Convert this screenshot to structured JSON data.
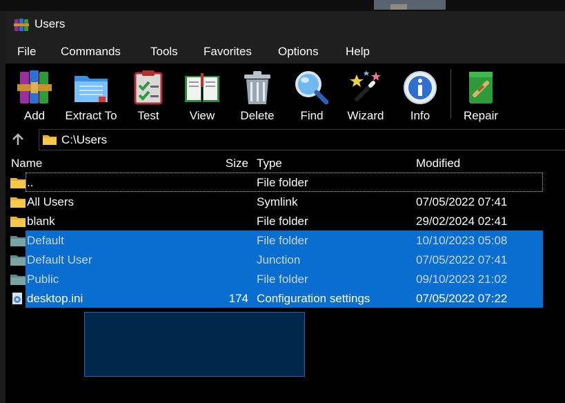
{
  "window": {
    "title": "Users"
  },
  "menu": [
    "File",
    "Commands",
    "Tools",
    "Favorites",
    "Options",
    "Help"
  ],
  "toolbar": [
    {
      "label": "Add",
      "icon": "add-archive-icon"
    },
    {
      "label": "Extract To",
      "icon": "extract-folder-icon"
    },
    {
      "label": "Test",
      "icon": "test-clipboard-icon"
    },
    {
      "label": "View",
      "icon": "view-book-icon"
    },
    {
      "label": "Delete",
      "icon": "trash-icon"
    },
    {
      "label": "Find",
      "icon": "magnifier-icon"
    },
    {
      "label": "Wizard",
      "icon": "wizard-wand-icon"
    },
    {
      "label": "Info",
      "icon": "info-icon"
    },
    {
      "label": "Repair",
      "icon": "repair-kit-icon"
    }
  ],
  "address": {
    "path": "C:\\Users"
  },
  "columns": {
    "name": "Name",
    "size": "Size",
    "type": "Type",
    "modified": "Modified"
  },
  "files": [
    {
      "name": "..",
      "size": "",
      "type": "File folder",
      "modified": "",
      "icon": "folder-icon"
    },
    {
      "name": "All Users",
      "size": "",
      "type": "Symlink",
      "modified": "07/05/2022 07:41",
      "icon": "folder-icon"
    },
    {
      "name": "blank",
      "size": "",
      "type": "File folder",
      "modified": "29/02/2024 02:41",
      "icon": "folder-icon"
    },
    {
      "name": "Default",
      "size": "",
      "type": "File folder",
      "modified": "10/10/2023 05:08",
      "icon": "folder-icon"
    },
    {
      "name": "Default User",
      "size": "",
      "type": "Junction",
      "modified": "07/05/2022 07:41",
      "icon": "folder-icon"
    },
    {
      "name": "Public",
      "size": "",
      "type": "File folder",
      "modified": "09/10/2023 21:02",
      "icon": "folder-icon"
    },
    {
      "name": "desktop.ini",
      "size": "174",
      "type": "Configuration settings",
      "modified": "07/05/2022 07:22",
      "icon": "settings-file-icon"
    }
  ],
  "colors": {
    "selection": "#0a6ed1",
    "background": "#000000",
    "chrome": "#1f1f1f"
  }
}
